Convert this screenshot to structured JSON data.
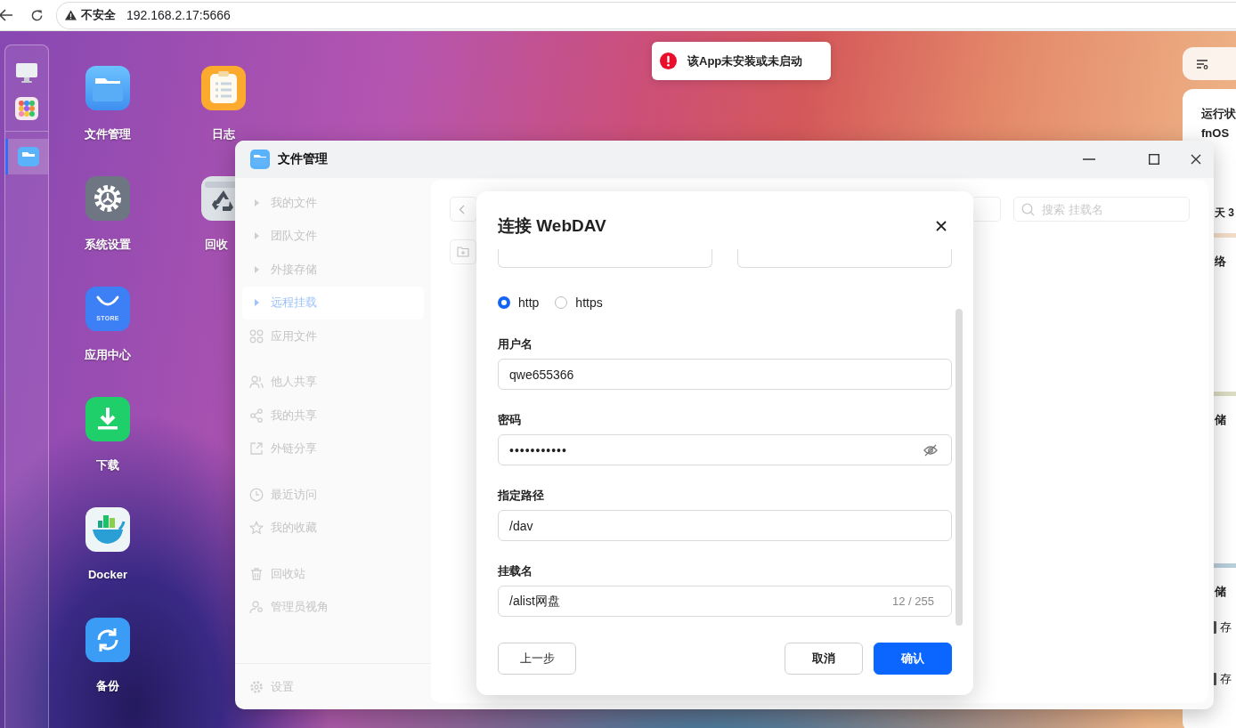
{
  "browser": {
    "security_label": "不安全",
    "url": "192.168.2.17:5666"
  },
  "dock": {
    "open_apps": [
      {
        "selected": true
      }
    ]
  },
  "desktop_icons": {
    "column_1": [
      {
        "label": "文件管理"
      },
      {
        "label": "系统设置"
      },
      {
        "label": "应用中心",
        "badge": "STORE"
      },
      {
        "label": "下载"
      },
      {
        "label": "Docker"
      },
      {
        "label": "备份"
      }
    ],
    "column_2": [
      {
        "label": "日志"
      },
      {
        "label": "回收"
      }
    ]
  },
  "toast": {
    "message": "该App未安装或未启动"
  },
  "widget_panel": {
    "title": "运行状",
    "system": "fnOS",
    "uptime": "天 3",
    "sections": [
      "络",
      "储",
      "储"
    ],
    "storage_items": [
      "存",
      "存"
    ]
  },
  "file_manager": {
    "title": "文件管理",
    "sidebar": {
      "groups": [
        [
          {
            "label": "我的文件",
            "kind": "expandable",
            "selected": false
          },
          {
            "label": "团队文件",
            "kind": "expandable",
            "selected": false
          },
          {
            "label": "外接存储",
            "kind": "expandable",
            "selected": false
          },
          {
            "label": "远程挂载",
            "kind": "expandable",
            "selected": true
          },
          {
            "label": "应用文件",
            "kind": "entry",
            "selected": false
          }
        ],
        [
          {
            "label": "他人共享",
            "kind": "entry",
            "selected": false
          },
          {
            "label": "我的共享",
            "kind": "entry",
            "selected": false
          },
          {
            "label": "外链分享",
            "kind": "entry",
            "selected": false
          }
        ],
        [
          {
            "label": "最近访问",
            "kind": "entry",
            "selected": false
          },
          {
            "label": "我的收藏",
            "kind": "entry",
            "selected": false
          }
        ],
        [
          {
            "label": "回收站",
            "kind": "entry",
            "selected": false
          },
          {
            "label": "管理员视角",
            "kind": "entry",
            "selected": false
          }
        ]
      ],
      "footer": "设置"
    },
    "search": {
      "placeholder": "搜索 挂载名"
    }
  },
  "dialog": {
    "title": "连接 WebDAV",
    "protocols": [
      {
        "label": "http",
        "selected": true
      },
      {
        "label": "https",
        "selected": false
      }
    ],
    "fields": [
      {
        "label": "用户名",
        "value": "qwe655366",
        "kind": "text"
      },
      {
        "label": "密码",
        "value": "•••••••••••",
        "kind": "password"
      },
      {
        "label": "指定路径",
        "value": "/dav",
        "kind": "text"
      },
      {
        "label": "挂载名",
        "value": "/alist网盘",
        "kind": "counted",
        "counter": "12 / 255"
      }
    ],
    "buttons": {
      "back": "上一步",
      "cancel": "取消",
      "confirm": "确认"
    }
  }
}
